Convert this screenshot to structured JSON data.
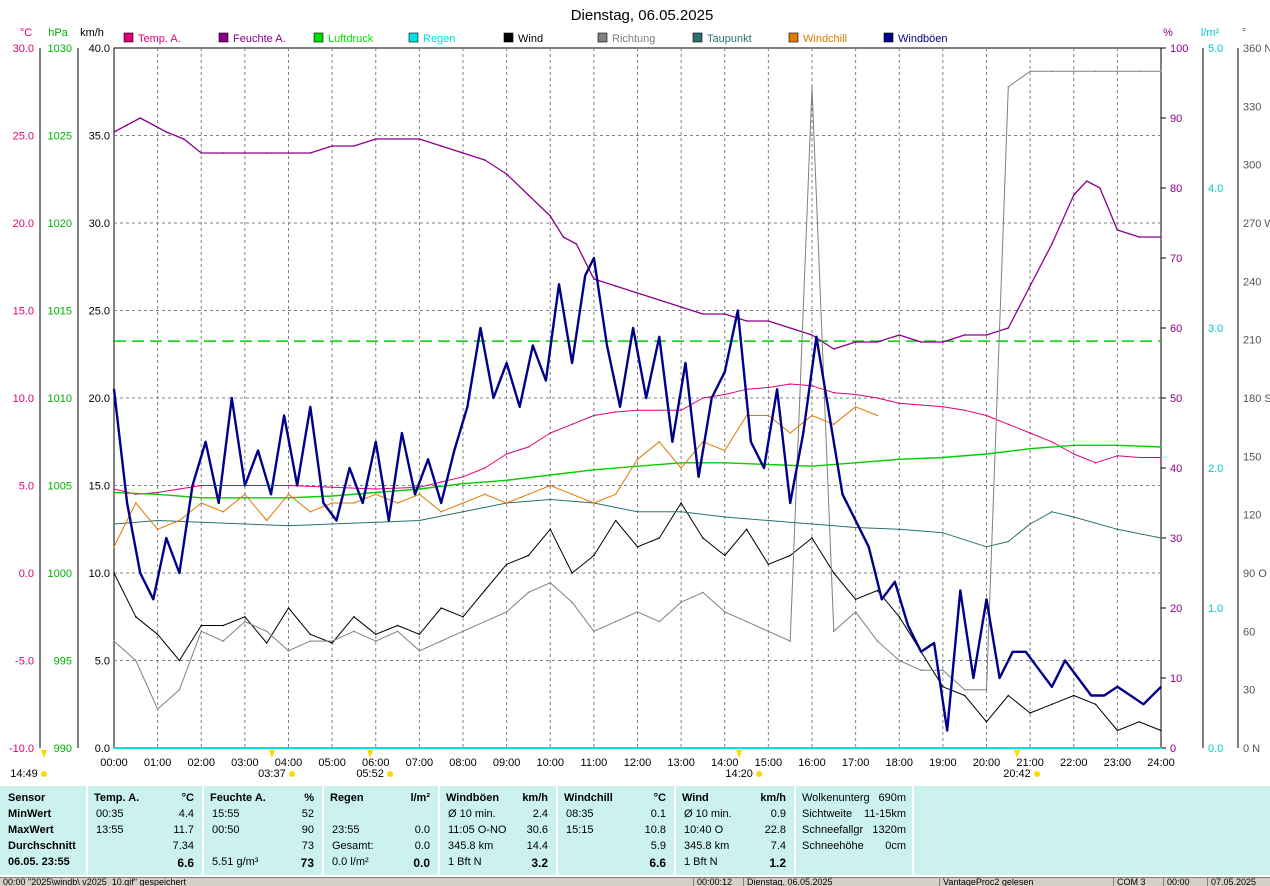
{
  "chart_data": {
    "type": "line",
    "title": "Dienstag, 06.05.2025",
    "x_tick_labels": [
      "00:00",
      "01:00",
      "02:00",
      "03:00",
      "04:00",
      "05:00",
      "06:00",
      "07:00",
      "08:00",
      "09:00",
      "10:00",
      "11:00",
      "12:00",
      "13:00",
      "14:00",
      "15:00",
      "16:00",
      "17:00",
      "18:00",
      "19:00",
      "20:00",
      "21:00",
      "22:00",
      "23:00",
      "24:00"
    ],
    "x_range_hours": [
      0,
      24
    ],
    "grid": true,
    "axes": {
      "temp": {
        "unit": "°C",
        "range": [
          -10,
          30
        ],
        "ticks": [
          "30.0",
          "25.0",
          "20.0",
          "15.0",
          "10.0",
          "5.0",
          "0.0",
          "-5.0",
          "-10.0"
        ],
        "color": "#e0007a"
      },
      "press": {
        "unit": "hPa",
        "range": [
          990,
          1030
        ],
        "ticks": [
          "1030",
          "1025",
          "1020",
          "1015",
          "1010",
          "1005",
          "1000",
          "995",
          "990"
        ],
        "color": "#00b000"
      },
      "wind": {
        "unit": "km/h",
        "range": [
          0,
          40
        ],
        "ticks": [
          "40.0",
          "35.0",
          "30.0",
          "25.0",
          "20.0",
          "15.0",
          "10.0",
          "5.0",
          "0.0"
        ],
        "color": "#000000"
      },
      "hum": {
        "unit": "%",
        "range": [
          0,
          100
        ],
        "ticks": [
          "100",
          "90",
          "80",
          "70",
          "60",
          "50",
          "40",
          "30",
          "20",
          "10",
          "0"
        ],
        "color": "#8a008a"
      },
      "rain": {
        "unit": "l/m²",
        "range": [
          0,
          5
        ],
        "ticks": [
          "5.0",
          "4.0",
          "3.0",
          "2.0",
          "1.0",
          "0.0"
        ],
        "color": "#00c8c8"
      },
      "dir": {
        "unit": "°",
        "range": [
          0,
          360
        ],
        "ticks": [
          "360 N",
          "330",
          "300",
          "270 W",
          "240",
          "210",
          "180 S",
          "150",
          "120",
          "90 O",
          "60",
          "30",
          "0 N"
        ],
        "color": "#555555"
      }
    },
    "legend": [
      {
        "name": "Temp. A.",
        "color": "#e0007a"
      },
      {
        "name": "Feuchte A.",
        "color": "#8a008a"
      },
      {
        "name": "Luftdruck",
        "color": "#00e000"
      },
      {
        "name": "Regen",
        "color": "#00e0e0"
      },
      {
        "name": "Wind",
        "color": "#000000"
      },
      {
        "name": "Richtung",
        "color": "#808080"
      },
      {
        "name": "Taupunkt",
        "color": "#2e6e6e"
      },
      {
        "name": "Windchill",
        "color": "#e07a00"
      },
      {
        "name": "Windböen",
        "color": "#00008b"
      }
    ],
    "series": [
      {
        "name": "Temp. A.",
        "axis": "temp",
        "color": "#e0007a",
        "x": [
          0,
          0.5,
          1,
          1.5,
          2,
          3,
          4,
          5,
          6,
          7,
          7.5,
          8,
          8.5,
          9,
          9.5,
          10,
          10.5,
          11,
          11.5,
          12,
          13,
          13.5,
          14,
          14.5,
          15,
          15.5,
          16,
          16.5,
          17,
          17.5,
          18,
          18.5,
          19,
          19.5,
          20,
          20.5,
          21,
          21.5,
          22,
          22.5,
          23,
          23.5,
          24
        ],
        "values": [
          4.8,
          4.5,
          4.6,
          4.8,
          5.0,
          5.0,
          5.0,
          4.9,
          4.8,
          4.9,
          5.2,
          5.5,
          6.0,
          6.8,
          7.2,
          8.0,
          8.5,
          9.0,
          9.2,
          9.3,
          9.3,
          10.0,
          10.2,
          10.5,
          10.6,
          10.8,
          10.7,
          10.3,
          10.2,
          10.0,
          9.7,
          9.6,
          9.5,
          9.3,
          9.0,
          8.5,
          8.0,
          7.5,
          6.8,
          6.3,
          6.7,
          6.6,
          6.6
        ]
      },
      {
        "name": "Feuchte A.",
        "axis": "hum",
        "color": "#8a008a",
        "x": [
          0,
          0.3,
          0.6,
          0.9,
          1.2,
          1.6,
          2.0,
          2.5,
          3.0,
          3.5,
          4.0,
          4.5,
          5.0,
          5.5,
          6.0,
          6.5,
          7.0,
          7.5,
          8.0,
          8.5,
          9.0,
          9.5,
          10.0,
          10.3,
          10.6,
          11.0,
          11.5,
          12.0,
          12.5,
          13.0,
          13.5,
          14.0,
          14.5,
          15.0,
          15.5,
          16.0,
          16.5,
          17.0,
          17.5,
          18.0,
          18.5,
          19.0,
          19.5,
          20.0,
          20.5,
          21.0,
          21.5,
          22.0,
          22.3,
          22.6,
          23.0,
          23.5,
          24
        ],
        "values": [
          88,
          89,
          90,
          89,
          88,
          87,
          85,
          85,
          85,
          85,
          85,
          85,
          86,
          86,
          87,
          87,
          87,
          86,
          85,
          84,
          82,
          79,
          76,
          73,
          72,
          67,
          66,
          65,
          64,
          63,
          62,
          62,
          61,
          61,
          60,
          59,
          57,
          58,
          58,
          59,
          58,
          58,
          59,
          59,
          60,
          66,
          72,
          79,
          81,
          80,
          74,
          73,
          73
        ]
      },
      {
        "name": "Luftdruck",
        "axis": "press",
        "color": "#00d000",
        "x": [
          0,
          1,
          2,
          3,
          4,
          5,
          6,
          7,
          8,
          9,
          10,
          11,
          12,
          13,
          14,
          15,
          16,
          17,
          18,
          19,
          20,
          21,
          22,
          23,
          24
        ],
        "values": [
          1004.6,
          1004.5,
          1004.3,
          1004.3,
          1004.3,
          1004.4,
          1004.6,
          1004.8,
          1005.1,
          1005.3,
          1005.6,
          1005.9,
          1006.1,
          1006.3,
          1006.3,
          1006.2,
          1006.1,
          1006.3,
          1006.5,
          1006.6,
          1006.8,
          1007.1,
          1007.3,
          1007.3,
          1007.2
        ]
      },
      {
        "name": "Regen",
        "axis": "rain",
        "color": "#00e0e0",
        "x": [
          0,
          24
        ],
        "values": [
          0.0,
          0.0
        ]
      },
      {
        "name": "Wind",
        "axis": "wind",
        "color": "#000000",
        "x": [
          0,
          0.5,
          1,
          1.5,
          2,
          2.5,
          3,
          3.5,
          4,
          4.5,
          5,
          5.5,
          6,
          6.5,
          7,
          7.5,
          8,
          8.5,
          9,
          9.5,
          10,
          10.5,
          11,
          11.5,
          12,
          12.5,
          13,
          13.5,
          14,
          14.5,
          15,
          15.5,
          16,
          16.5,
          17,
          17.5,
          18,
          18.5,
          19,
          19.5,
          20,
          20.5,
          21,
          21.5,
          22,
          22.5,
          23,
          23.5,
          24
        ],
        "values": [
          10.0,
          7.5,
          6.5,
          5.0,
          7.0,
          7.0,
          7.5,
          6.0,
          8.0,
          6.5,
          6.0,
          7.5,
          6.5,
          7.0,
          6.5,
          8.0,
          7.5,
          9.0,
          10.5,
          11.0,
          12.5,
          10.0,
          11.0,
          13.0,
          11.5,
          12.0,
          14.0,
          12.0,
          11.0,
          12.5,
          10.5,
          11.0,
          12.0,
          10.0,
          8.5,
          9.0,
          7.5,
          5.5,
          3.5,
          3.0,
          1.5,
          3.0,
          2.0,
          2.5,
          3.0,
          2.5,
          1.0,
          1.5,
          1.0
        ]
      },
      {
        "name": "Richtung",
        "axis": "dir",
        "color": "#808080",
        "x": [
          0,
          0.5,
          1,
          1.5,
          2,
          2.5,
          3,
          3.5,
          4,
          4.5,
          5,
          5.5,
          6,
          6.5,
          7,
          7.5,
          8,
          8.5,
          9,
          9.5,
          10,
          10.5,
          11,
          11.5,
          12,
          12.5,
          13,
          13.5,
          14,
          14.5,
          15,
          15.5,
          16,
          16.5,
          17,
          17.5,
          18,
          18.5,
          19,
          19.5,
          20,
          20.5,
          21,
          21.5,
          22,
          22.5,
          23,
          23.5,
          24
        ],
        "values": [
          55,
          45,
          20,
          30,
          60,
          55,
          65,
          60,
          50,
          55,
          55,
          60,
          55,
          60,
          50,
          55,
          60,
          65,
          70,
          80,
          85,
          75,
          60,
          65,
          70,
          65,
          75,
          80,
          70,
          65,
          60,
          55,
          340,
          60,
          70,
          55,
          45,
          40,
          40,
          30,
          30,
          340,
          348,
          348,
          348,
          348,
          348,
          348,
          348
        ]
      },
      {
        "name": "Taupunkt",
        "axis": "temp",
        "color": "#2e6e6e",
        "x": [
          0,
          1,
          2,
          3,
          4,
          5,
          6,
          7,
          8,
          9,
          10,
          11,
          12,
          13,
          14,
          15,
          16,
          17,
          18,
          19,
          20,
          20.5,
          21,
          21.5,
          22,
          23,
          24
        ],
        "values": [
          2.8,
          3.0,
          2.9,
          2.8,
          2.7,
          2.8,
          2.9,
          3.0,
          3.5,
          4.0,
          4.2,
          4.0,
          3.5,
          3.5,
          3.2,
          3.0,
          2.8,
          2.6,
          2.5,
          2.3,
          1.5,
          1.8,
          2.8,
          3.5,
          3.2,
          2.5,
          2.0
        ]
      },
      {
        "name": "Windchill",
        "axis": "temp",
        "color": "#e07a00",
        "x": [
          0,
          0.5,
          1,
          1.5,
          2,
          2.5,
          3,
          3.5,
          4,
          4.5,
          5,
          5.5,
          6,
          6.5,
          7,
          7.5,
          8,
          8.5,
          9,
          9.5,
          10,
          10.5,
          11,
          11.5,
          12,
          12.5,
          13,
          13.5,
          14,
          14.5,
          15,
          15.5,
          16,
          16.5,
          17,
          17.5
        ],
        "values": [
          1.5,
          4.0,
          2.5,
          3.0,
          4.0,
          3.5,
          4.5,
          3.0,
          4.5,
          3.5,
          4.0,
          4.0,
          4.5,
          4.0,
          4.5,
          3.5,
          4.0,
          4.5,
          4.0,
          4.5,
          5.0,
          4.5,
          4.0,
          4.5,
          6.5,
          7.5,
          6.0,
          7.5,
          7.0,
          9.0,
          9.0,
          8.0,
          9.0,
          8.5,
          9.5,
          9.0
        ]
      },
      {
        "name": "Windböen",
        "axis": "wind",
        "color": "#00008b",
        "x": [
          0,
          0.3,
          0.6,
          0.9,
          1.2,
          1.5,
          1.8,
          2.1,
          2.4,
          2.7,
          3.0,
          3.3,
          3.6,
          3.9,
          4.2,
          4.5,
          4.8,
          5.1,
          5.4,
          5.7,
          6.0,
          6.3,
          6.6,
          6.9,
          7.2,
          7.5,
          7.8,
          8.1,
          8.4,
          8.7,
          9.0,
          9.3,
          9.6,
          9.9,
          10.2,
          10.5,
          10.8,
          11.0,
          11.3,
          11.6,
          11.9,
          12.2,
          12.5,
          12.8,
          13.1,
          13.4,
          13.7,
          14.0,
          14.3,
          14.6,
          14.9,
          15.2,
          15.5,
          15.8,
          16.1,
          16.4,
          16.7,
          17.0,
          17.3,
          17.6,
          17.9,
          18.2,
          18.5,
          18.8,
          19.1,
          19.4,
          19.7,
          20.0,
          20.3,
          20.6,
          20.9,
          21.2,
          21.5,
          21.8,
          22.1,
          22.4,
          22.7,
          23.0,
          23.3,
          23.6,
          24
        ],
        "values": [
          20.5,
          14.0,
          10.0,
          8.5,
          12.0,
          10.0,
          15.0,
          17.5,
          14.0,
          20.0,
          15.0,
          17.0,
          14.5,
          19.0,
          15.0,
          19.5,
          14.0,
          13.0,
          16.0,
          14.0,
          17.5,
          13.0,
          18.0,
          14.5,
          16.5,
          14.0,
          17.0,
          19.5,
          24.0,
          20.0,
          22.0,
          19.5,
          23.0,
          21.0,
          26.5,
          22.0,
          27.0,
          28.0,
          23.0,
          19.5,
          24.0,
          20.0,
          23.5,
          17.5,
          22.0,
          15.5,
          20.0,
          21.5,
          25.0,
          17.5,
          16.0,
          20.5,
          14.0,
          18.0,
          23.5,
          19.0,
          14.5,
          13.0,
          11.5,
          8.5,
          9.5,
          7.0,
          5.5,
          6.0,
          1.0,
          9.0,
          4.0,
          8.5,
          4.0,
          5.5,
          5.5,
          4.5,
          3.5,
          5.0,
          4.0,
          3.0,
          3.0,
          3.5,
          3.0,
          2.5,
          3.5
        ]
      }
    ],
    "reference_line": {
      "axis": "press",
      "value": 1013.25,
      "color": "#00d000",
      "style": "dashed"
    },
    "time_markers": [
      {
        "label": "14:49",
        "x": -0.6,
        "color": "#ffd700"
      },
      {
        "label": "03:37",
        "x": 3.62,
        "color": "#ffd700"
      },
      {
        "label": "05:52",
        "x": 5.87,
        "color": "#ffd700"
      },
      {
        "label": "14:20",
        "x": 14.33,
        "color": "#ffd700"
      },
      {
        "label": "20:42",
        "x": 20.7,
        "color": "#ffd700"
      }
    ]
  },
  "stats": {
    "sensor": {
      "header": "Sensor",
      "rows": [
        "MinWert",
        "MaxWert",
        "Durchschnitt",
        "06.05. 23:55"
      ]
    },
    "temp": {
      "header": "Temp. A.",
      "unit": "°C",
      "rows": [
        [
          "00:35",
          "4.4"
        ],
        [
          "13:55",
          "11.7"
        ],
        [
          "",
          "7.34"
        ],
        [
          "",
          "6.6"
        ]
      ]
    },
    "hum": {
      "header": "Feuchte A.",
      "unit": "%",
      "rows": [
        [
          "15:55",
          "52"
        ],
        [
          "00:50",
          "90"
        ],
        [
          "",
          "73"
        ],
        [
          "5.51 g/m³",
          "73"
        ]
      ]
    },
    "rain": {
      "header": "Regen",
      "unit": "l/m²",
      "rows": [
        [
          "",
          ""
        ],
        [
          "23:55",
          "0.0"
        ],
        [
          "Gesamt:",
          "0.0"
        ],
        [
          "0.0 l/m²",
          "0.0"
        ]
      ]
    },
    "gust": {
      "header": "Windböen",
      "unit": "km/h",
      "rows": [
        [
          "Ø 10 min.",
          "2.4"
        ],
        [
          "11:05   O-NO",
          "30.6"
        ],
        [
          "345.8 km",
          "14.4"
        ],
        [
          "1 Bft N",
          "3.2"
        ]
      ]
    },
    "chill": {
      "header": "Windchill",
      "unit": "°C",
      "rows": [
        [
          "08:35",
          "0.1"
        ],
        [
          "15:15",
          "10.8"
        ],
        [
          "",
          "5.9"
        ],
        [
          "",
          "6.6"
        ]
      ]
    },
    "wind": {
      "header": "Wind",
      "unit": "km/h",
      "rows": [
        [
          "Ø 10 min.",
          "0.9"
        ],
        [
          "10:40   O",
          "22.8"
        ],
        [
          "345.8 km",
          "7.4"
        ],
        [
          "1 Bft N",
          "1.2"
        ]
      ]
    },
    "extra": [
      [
        "Wolkenunterg",
        "690m"
      ],
      [
        "Sichtweite",
        "11-15km"
      ],
      [
        "Schneefallgr",
        "1320m"
      ],
      [
        "Schneehöhe",
        "0cm"
      ]
    ]
  },
  "statusbar": [
    "00:00  \"2025\\windb\\ v2025_10.gif\" gespeichert",
    "00:00:12",
    "Dienstag, 06.05.2025",
    "VantageProc2 gelesen",
    "COM 3",
    "00:00",
    "07.05.2025"
  ]
}
